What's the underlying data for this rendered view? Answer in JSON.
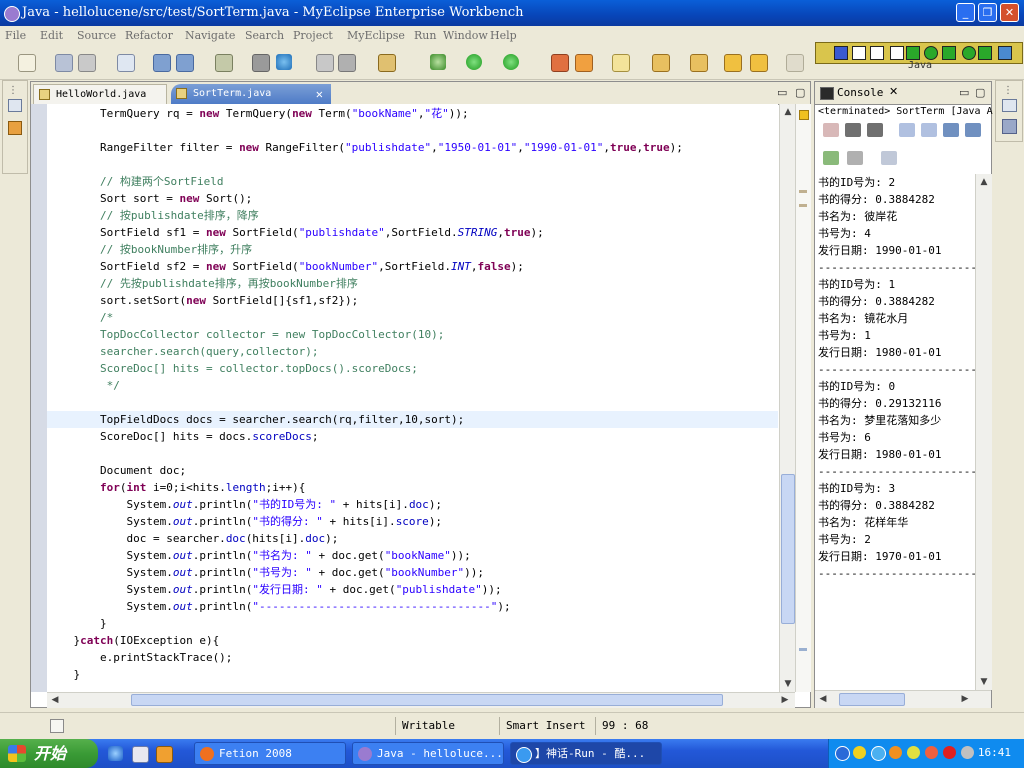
{
  "window": {
    "title": "Java - hellolucene/src/test/SortTerm.java - MyEclipse Enterprise Workbench"
  },
  "menu": [
    "File",
    "Edit",
    "Source",
    "Refactor",
    "Navigate",
    "Search",
    "Project",
    "MyEclipse",
    "Run",
    "Window",
    "Help"
  ],
  "perspective": {
    "label": "Java"
  },
  "editor": {
    "tabs": [
      {
        "label": "HelloWorld.java",
        "active": false
      },
      {
        "label": "SortTerm.java",
        "active": true
      }
    ],
    "lines": [
      "        TermQuery rq = new TermQuery(new Term(\"bookName\",\"花\"));",
      "",
      "        RangeFilter filter = new RangeFilter(\"publishdate\",\"1950-01-01\",\"1990-01-01\",true,true);",
      "",
      "        // 构建两个SortField",
      "        Sort sort = new Sort();",
      "        // 按publishdate排序，降序",
      "        SortField sf1 = new SortField(\"publishdate\",SortField.STRING,true);",
      "        // 按bookNumber排序，升序",
      "        SortField sf2 = new SortField(\"bookNumber\",SortField.INT,false);",
      "        // 先按publishdate排序，再按bookNumber排序",
      "        sort.setSort(new SortField[]{sf1,sf2});",
      "        /*",
      "        TopDocCollector collector = new TopDocCollector(10);",
      "        searcher.search(query,collector);",
      "        ScoreDoc[] hits = collector.topDocs().scoreDocs;",
      "         */",
      "",
      "        TopFieldDocs docs = searcher.search(rq,filter,10,sort);",
      "        ScoreDoc[] hits = docs.scoreDocs;",
      "",
      "        Document doc;",
      "        for(int i=0;i<hits.length;i++){",
      "            System.out.println(\"书的ID号为: \" + hits[i].doc);",
      "            System.out.println(\"书的得分: \" + hits[i].score);",
      "            doc = searcher.doc(hits[i].doc);",
      "            System.out.println(\"书名为: \" + doc.get(\"bookName\"));",
      "            System.out.println(\"书号为: \" + doc.get(\"bookNumber\"));",
      "            System.out.println(\"发行日期: \" + doc.get(\"publishdate\"));",
      "            System.out.println(\"-----------------------------------\");",
      "        }",
      "    }catch(IOException e){",
      "        e.printStackTrace();",
      "    }"
    ]
  },
  "console": {
    "tab_label": "Console",
    "status": "<terminated> SortTerm [Java A",
    "lines": [
      "书的ID号为: 2",
      "书的得分: 0.3884282",
      "书名为: 彼岸花",
      "书号为: 4",
      "发行日期: 1990-01-01",
      "-----------------------------------",
      "书的ID号为: 1",
      "书的得分: 0.3884282",
      "书名为: 镜花水月",
      "书号为: 1",
      "发行日期: 1980-01-01",
      "-----------------------------------",
      "书的ID号为: 0",
      "书的得分: 0.29132116",
      "书名为: 梦里花落知多少",
      "书号为: 6",
      "发行日期: 1980-01-01",
      "-----------------------------------",
      "书的ID号为: 3",
      "书的得分: 0.3884282",
      "书名为: 花样年华",
      "书号为: 2",
      "发行日期: 1970-01-01",
      "-----------------------------------"
    ]
  },
  "status": {
    "writable": "Writable",
    "insert_mode": "Smart Insert",
    "position": "99 : 68"
  },
  "taskbar": {
    "start_label": "开始",
    "tasks": [
      {
        "label": "Fetion 2008"
      },
      {
        "label": "Java - helloluce..."
      },
      {
        "label": "】神话-Run - 酷..."
      }
    ],
    "clock": "16:41"
  },
  "colors": {
    "keyword": "#7f0055",
    "string": "#2a00ff",
    "comment": "#3f7f5f",
    "field": "#0000c0"
  }
}
